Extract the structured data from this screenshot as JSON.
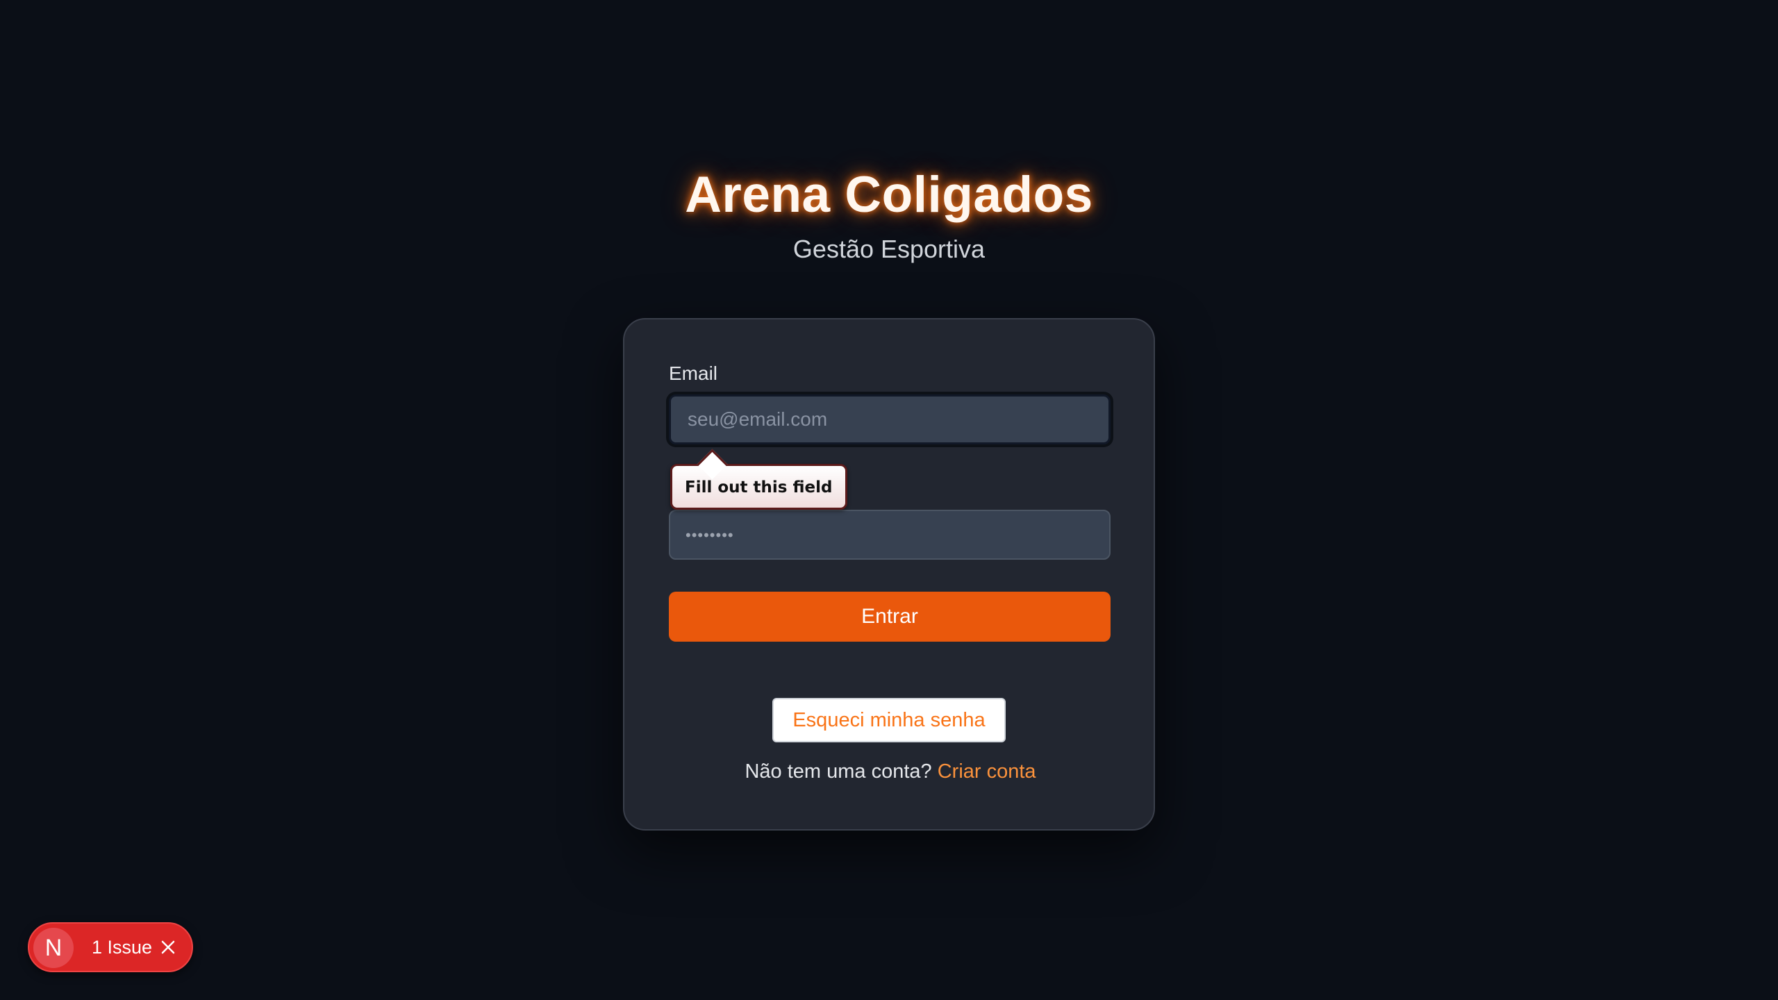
{
  "brand": {
    "title": "Arena Coligados",
    "subtitle": "Gestão Esportiva"
  },
  "form": {
    "email_label": "Email",
    "email_placeholder": "seu@email.com",
    "email_value": "",
    "password_placeholder": "••••••••",
    "validation_tooltip": "Fill out this field",
    "submit_label": "Entrar",
    "forgot_label": "Esqueci minha senha",
    "signup_prompt": "Não tem uma conta?",
    "signup_link": "Criar conta"
  },
  "dev_overlay": {
    "logo_letter": "N",
    "issues_label": "1 Issue"
  },
  "colors": {
    "background": "#0b0f17",
    "card": "#222630",
    "accent": "#ea580c",
    "link": "#fb923c",
    "issue_badge": "#dc2626"
  }
}
